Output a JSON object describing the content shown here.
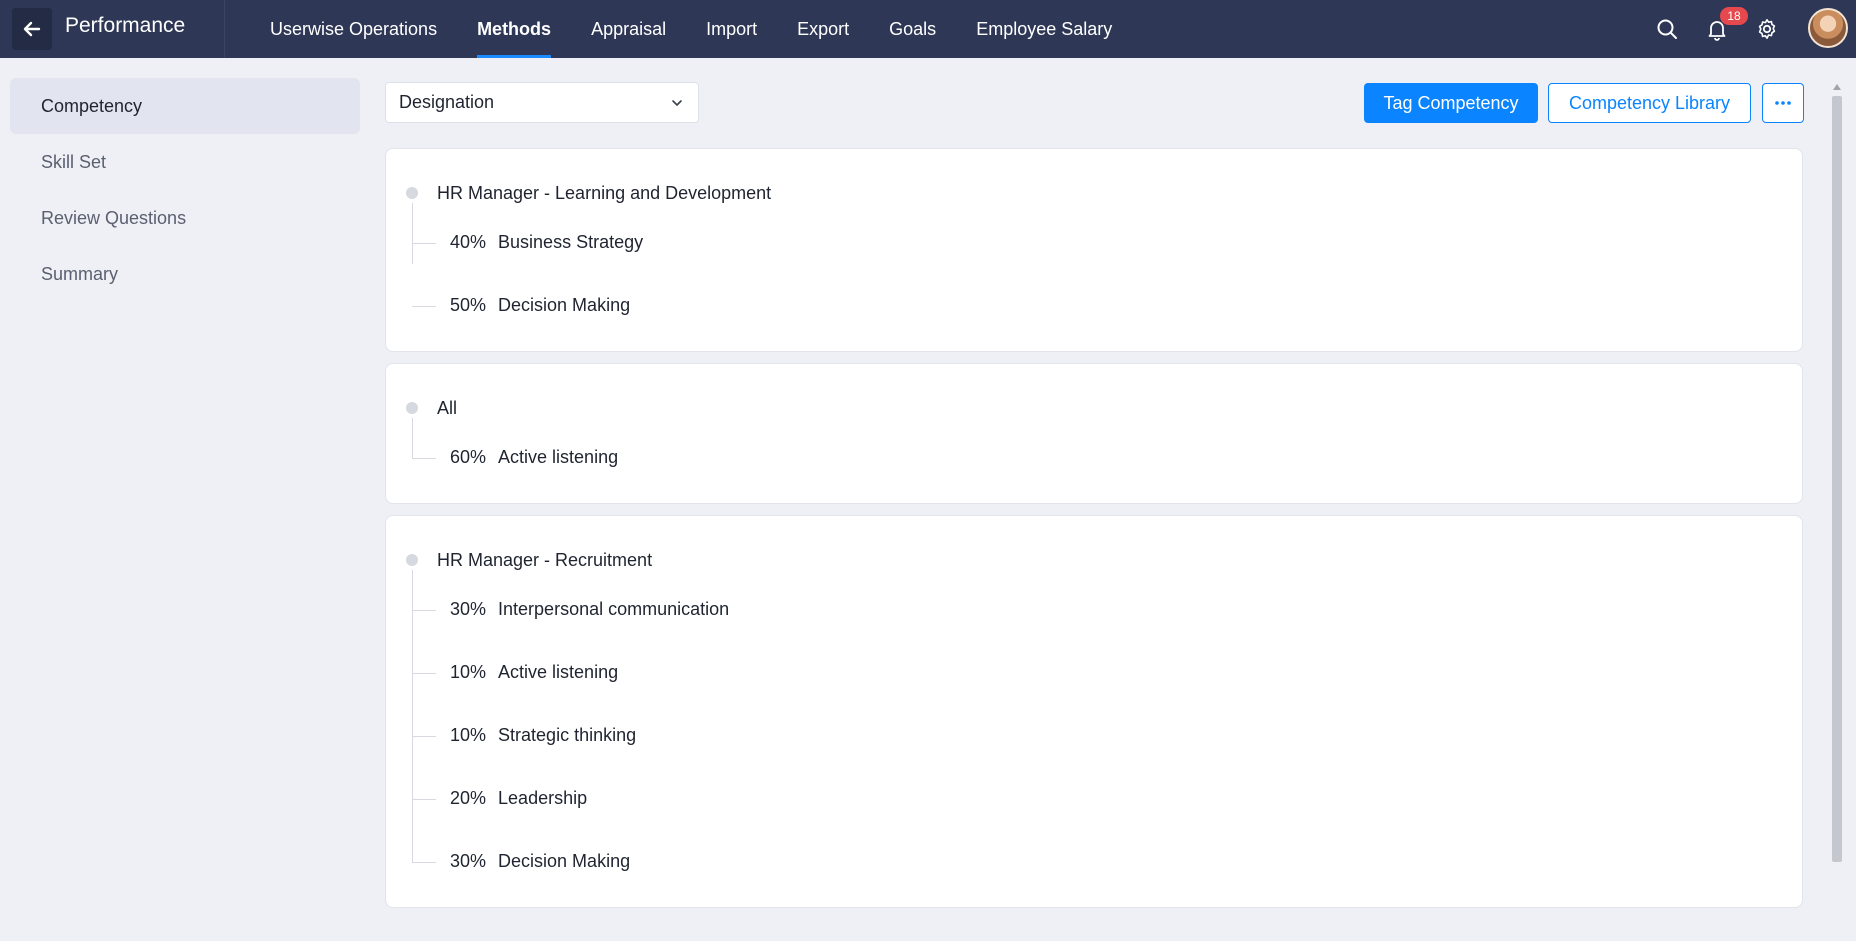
{
  "header": {
    "back_icon": "arrow-left-icon",
    "app_title": "Performance",
    "nav": [
      {
        "label": "Userwise Operations",
        "active": false
      },
      {
        "label": "Methods",
        "active": true
      },
      {
        "label": "Appraisal",
        "active": false
      },
      {
        "label": "Import",
        "active": false
      },
      {
        "label": "Export",
        "active": false
      },
      {
        "label": "Goals",
        "active": false
      },
      {
        "label": "Employee Salary",
        "active": false
      }
    ],
    "notification_count": "18",
    "icons": [
      "search-icon",
      "bell-icon",
      "gear-icon",
      "avatar"
    ]
  },
  "sidebar": {
    "items": [
      {
        "label": "Competency",
        "active": true
      },
      {
        "label": "Skill Set",
        "active": false
      },
      {
        "label": "Review Questions",
        "active": false
      },
      {
        "label": "Summary",
        "active": false
      }
    ]
  },
  "toolbar": {
    "select_value": "Designation",
    "tag_label": "Tag Competency",
    "library_label": "Competency Library",
    "more_icon": "more-horizontal-icon"
  },
  "cards": [
    {
      "title": "HR Manager - Learning and Development",
      "items": [
        {
          "percent": "40%",
          "name": "Business Strategy"
        },
        {
          "percent": "50%",
          "name": "Decision Making"
        }
      ]
    },
    {
      "title": "All",
      "items": [
        {
          "percent": "60%",
          "name": "Active listening"
        }
      ]
    },
    {
      "title": "HR Manager - Recruitment",
      "items": [
        {
          "percent": "30%",
          "name": "Interpersonal communication"
        },
        {
          "percent": "10%",
          "name": "Active listening"
        },
        {
          "percent": "10%",
          "name": "Strategic thinking"
        },
        {
          "percent": "20%",
          "name": "Leadership"
        },
        {
          "percent": "30%",
          "name": "Decision Making"
        }
      ]
    }
  ],
  "colors": {
    "topbar": "#2e3856",
    "accent": "#0a84ff",
    "badge": "#e5484d",
    "page_bg": "#eef0f5"
  }
}
